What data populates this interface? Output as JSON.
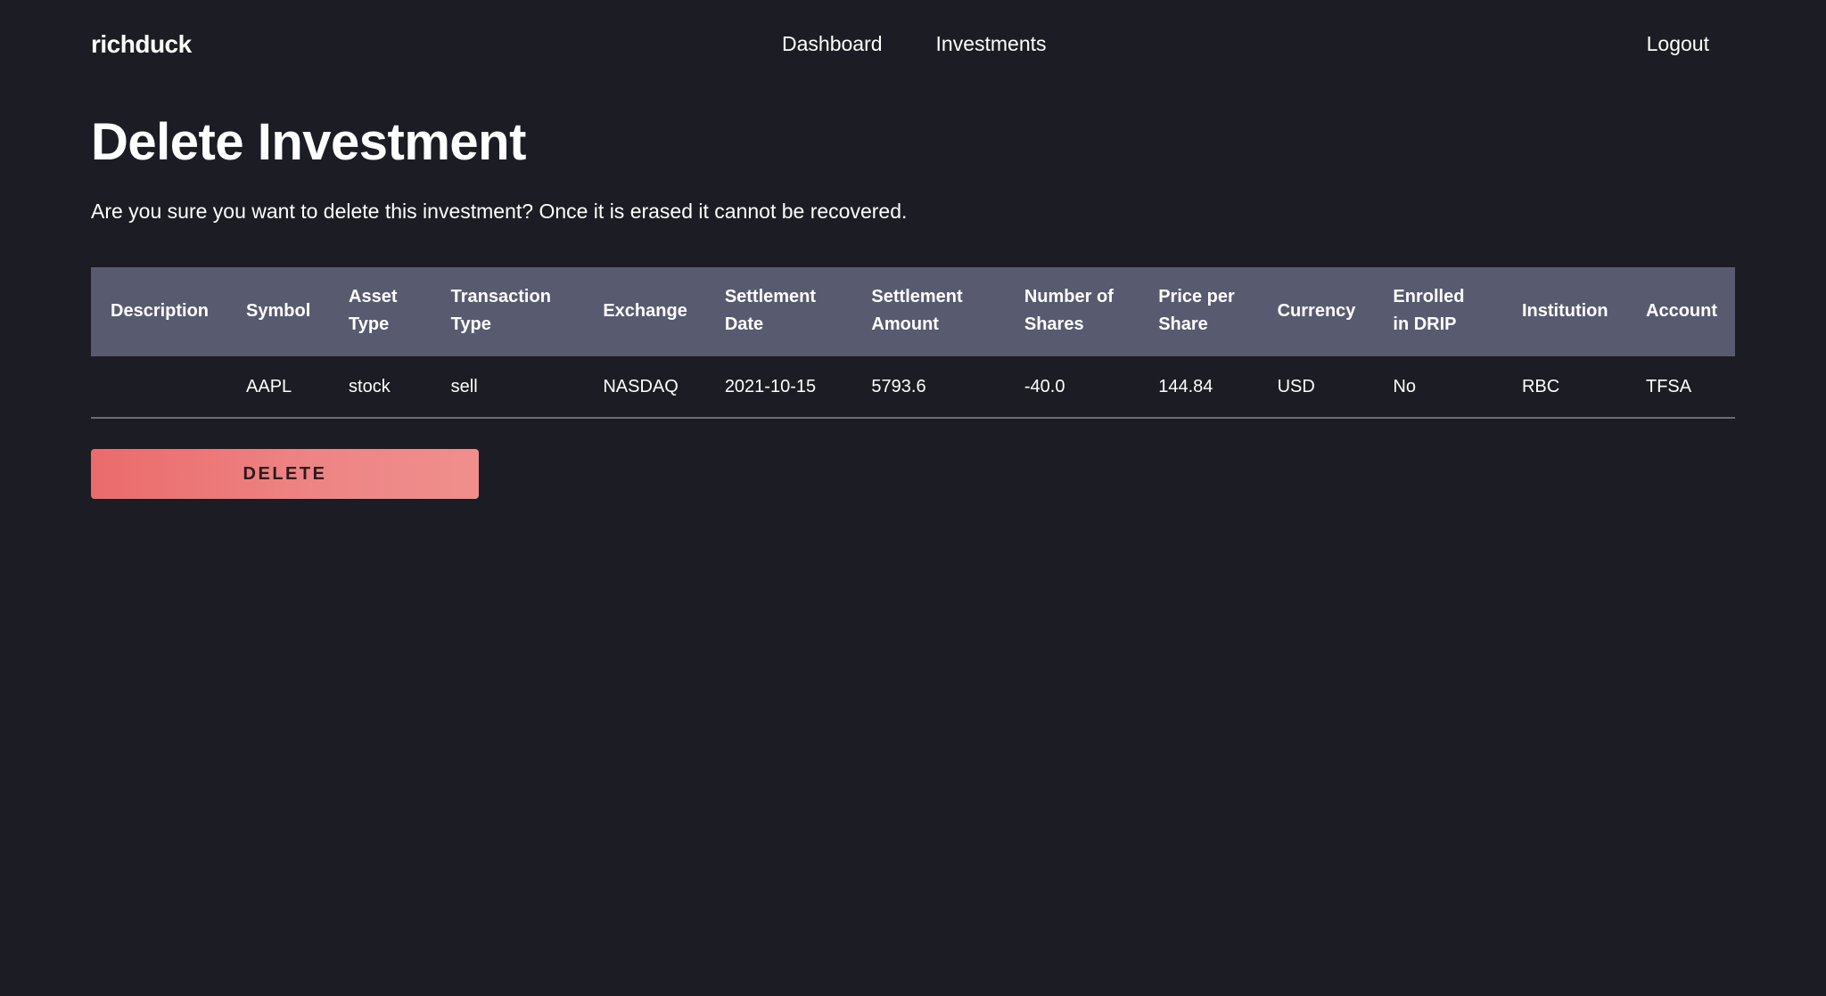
{
  "nav": {
    "brand": "richduck",
    "links": [
      "Dashboard",
      "Investments"
    ],
    "logout": "Logout"
  },
  "page": {
    "title": "Delete Investment",
    "description": "Are you sure you want to delete this investment? Once it is erased it cannot be recovered."
  },
  "table": {
    "headers": [
      "Description",
      "Symbol",
      "Asset Type",
      "Transaction Type",
      "Exchange",
      "Settlement Date",
      "Settlement Amount",
      "Number of Shares",
      "Price per Share",
      "Currency",
      "Enrolled in DRIP",
      "Institution",
      "Account"
    ],
    "row": [
      "",
      "AAPL",
      "stock",
      "sell",
      "NASDAQ",
      "2021-10-15",
      "5793.6",
      "-40.0",
      "144.84",
      "USD",
      "No",
      "RBC",
      "TFSA"
    ]
  },
  "actions": {
    "delete_label": "DELETE"
  },
  "colors": {
    "background": "#1c1c24",
    "table_header": "#585a6f",
    "delete_button": "#eb6b6b"
  }
}
